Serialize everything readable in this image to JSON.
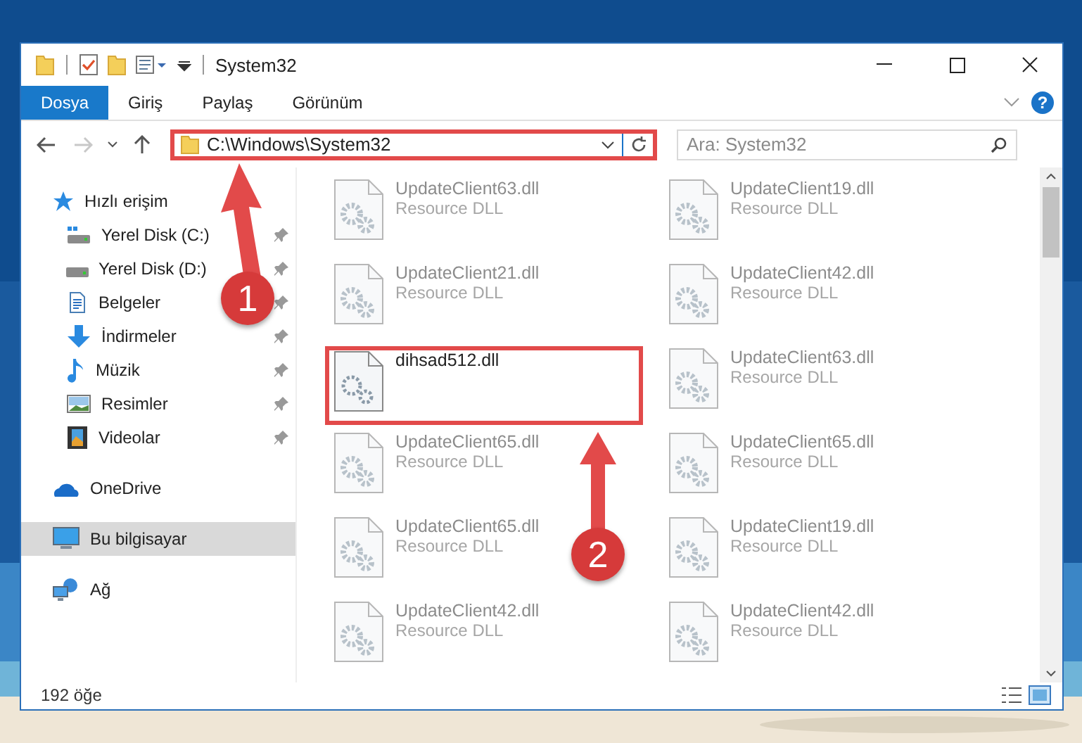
{
  "window": {
    "title": "System32"
  },
  "ribbon": {
    "tabs": [
      {
        "label": "Dosya",
        "kind": "file"
      },
      {
        "label": "Giriş",
        "kind": "tab"
      },
      {
        "label": "Paylaş",
        "kind": "tab"
      },
      {
        "label": "Görünüm",
        "kind": "tab"
      }
    ],
    "help": "?"
  },
  "address_bar": {
    "path": "C:\\Windows\\System32",
    "highlighted": true
  },
  "search": {
    "placeholder": "Ara: System32"
  },
  "sidebar": {
    "items": [
      {
        "label": "Hızlı erişim",
        "selected": false,
        "children": [
          {
            "label": "Yerel Disk (C:)",
            "selected": false,
            "pinned": true
          },
          {
            "label": "Yerel Disk (D:)",
            "selected": false,
            "pinned": true
          },
          {
            "label": "Belgeler",
            "selected": false,
            "pinned": true
          },
          {
            "label": "İndirmeler",
            "selected": false,
            "pinned": true
          },
          {
            "label": "Müzik",
            "selected": false,
            "pinned": true
          },
          {
            "label": "Resimler",
            "selected": false,
            "pinned": true
          },
          {
            "label": "Videolar",
            "selected": false,
            "pinned": true
          }
        ]
      },
      {
        "label": "OneDrive",
        "selected": false
      },
      {
        "label": "Bu bilgisayar",
        "selected": true
      },
      {
        "label": "Ağ",
        "selected": false
      }
    ]
  },
  "files": [
    {
      "name": "UpdateClient63.dll",
      "type": "Resource DLL",
      "blurred": true,
      "highlighted": false
    },
    {
      "name": "UpdateClient19.dll",
      "type": "Resource DLL",
      "blurred": true,
      "highlighted": false
    },
    {
      "name": "UpdateClient21.dll",
      "type": "Resource DLL",
      "blurred": true,
      "highlighted": false
    },
    {
      "name": "UpdateClient42.dll",
      "type": "Resource DLL",
      "blurred": true,
      "highlighted": false
    },
    {
      "name": "dihsad512.dll",
      "blurred": false,
      "highlighted": true
    },
    {
      "name": "UpdateClient63.dll",
      "type": "Resource DLL",
      "blurred": true,
      "highlighted": false
    },
    {
      "name": "UpdateClient65.dll",
      "type": "Resource DLL",
      "blurred": true,
      "highlighted": false
    },
    {
      "name": "UpdateClient65.dll",
      "type": "Resource DLL",
      "blurred": true,
      "highlighted": false
    },
    {
      "name": "UpdateClient65.dll",
      "type": "Resource DLL",
      "blurred": true,
      "highlighted": false
    },
    {
      "name": "UpdateClient19.dll",
      "type": "Resource DLL",
      "blurred": true,
      "highlighted": false
    },
    {
      "name": "UpdateClient42.dll",
      "type": "Resource DLL",
      "blurred": true,
      "highlighted": false
    },
    {
      "name": "UpdateClient42.dll",
      "type": "Resource DLL",
      "blurred": true,
      "highlighted": false
    }
  ],
  "status_bar": {
    "item_count": "192 öğe"
  },
  "annotations": [
    {
      "label": "1"
    },
    {
      "label": "2"
    }
  ]
}
